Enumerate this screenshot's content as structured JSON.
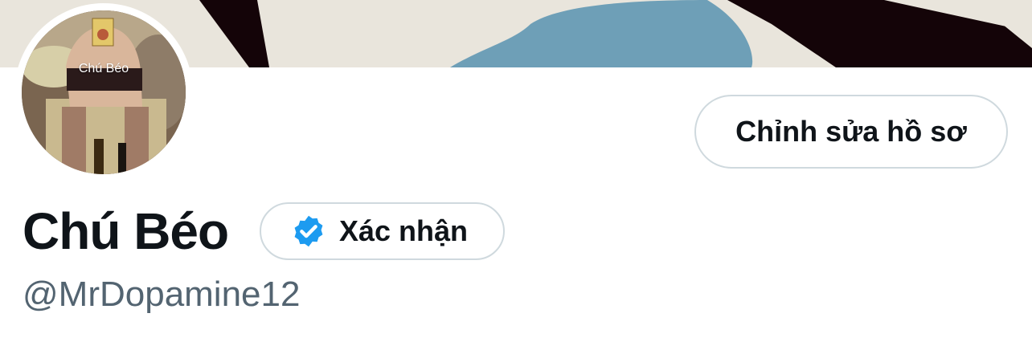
{
  "profile": {
    "avatar_caption": "Chú Béo",
    "display_name": "Chú Béo",
    "handle": "@MrDopamine12",
    "edit_profile_label": "Chỉnh sửa hồ sơ",
    "verify_label": "Xác nhận"
  },
  "colors": {
    "text_primary": "#0f1419",
    "text_secondary": "#536471",
    "border": "#cfd9de",
    "verified_blue": "#1d9bf0",
    "banner_dark": "#140408",
    "banner_blue": "#6e9fb7"
  },
  "icons": {
    "verified": "verified-badge-icon"
  }
}
